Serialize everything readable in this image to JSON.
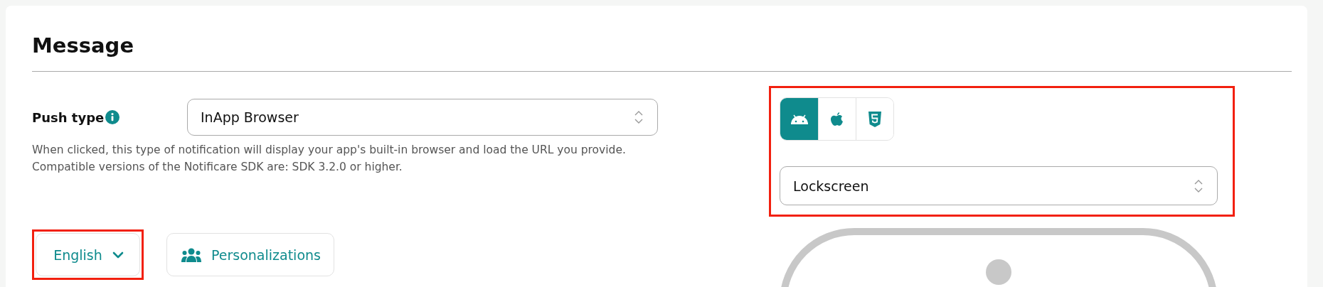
{
  "section": {
    "title": "Message"
  },
  "push_type": {
    "label": "Push type",
    "value": "InApp Browser",
    "description": "When clicked, this type of notification will display your app's built-in browser and load the URL you provide.\nCompatible versions of the Notificare SDK are: SDK 3.2.0 or higher."
  },
  "language": {
    "label": "English",
    "highlighted": true
  },
  "personalizations": {
    "label": "Personalizations"
  },
  "preview": {
    "highlighted": true,
    "platforms": [
      {
        "kind": "android",
        "selected": true
      },
      {
        "kind": "apple",
        "selected": false
      },
      {
        "kind": "html5",
        "selected": false
      }
    ],
    "view": {
      "value": "Lockscreen"
    }
  }
}
